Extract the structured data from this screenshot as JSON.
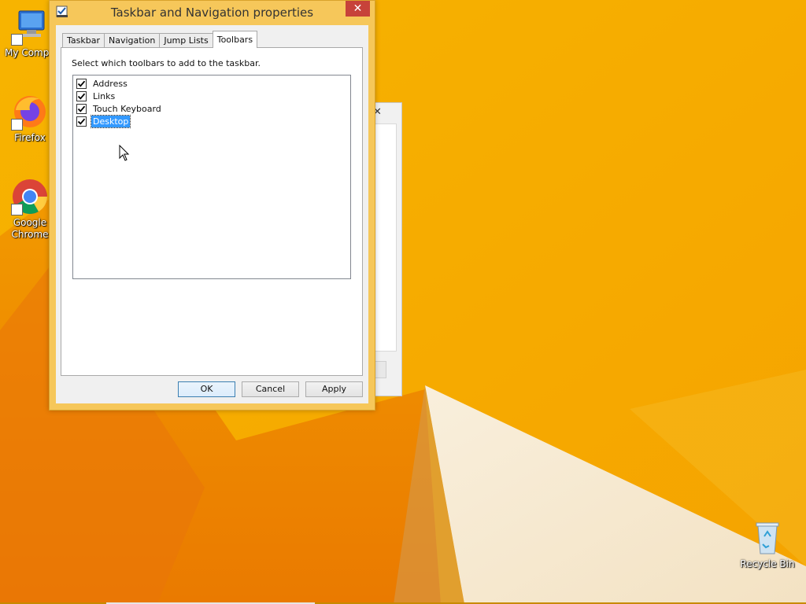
{
  "desktop": {
    "icons": [
      {
        "label": "My Compu",
        "icon": "computer-icon"
      },
      {
        "label": "Firefox",
        "icon": "firefox-icon"
      },
      {
        "label": "Google Chrome",
        "icon": "chrome-icon"
      },
      {
        "label": "Recycle Bin",
        "icon": "recycle-bin-icon"
      }
    ],
    "colors": {
      "wallpaper_primary": "#f5a800",
      "wallpaper_light": "#f7eedc"
    }
  },
  "dialog": {
    "title": "Taskbar and Navigation properties",
    "close_label": "✕",
    "tabs": [
      {
        "label": "Taskbar",
        "active": false
      },
      {
        "label": "Navigation",
        "active": false
      },
      {
        "label": "Jump Lists",
        "active": false
      },
      {
        "label": "Toolbars",
        "active": true
      }
    ],
    "instruction": "Select which toolbars to add to the taskbar.",
    "toolbars": [
      {
        "label": "Address",
        "checked": true,
        "selected": false
      },
      {
        "label": "Links",
        "checked": true,
        "selected": false
      },
      {
        "label": "Touch Keyboard",
        "checked": true,
        "selected": false
      },
      {
        "label": "Desktop",
        "checked": true,
        "selected": true
      }
    ],
    "buttons": {
      "ok": "OK",
      "cancel": "Cancel",
      "apply": "Apply"
    },
    "colors": {
      "frame": "#f6c75a",
      "close": "#c7423a",
      "selection": "#3399ff"
    }
  },
  "background_window": {
    "close_label": "✕"
  }
}
